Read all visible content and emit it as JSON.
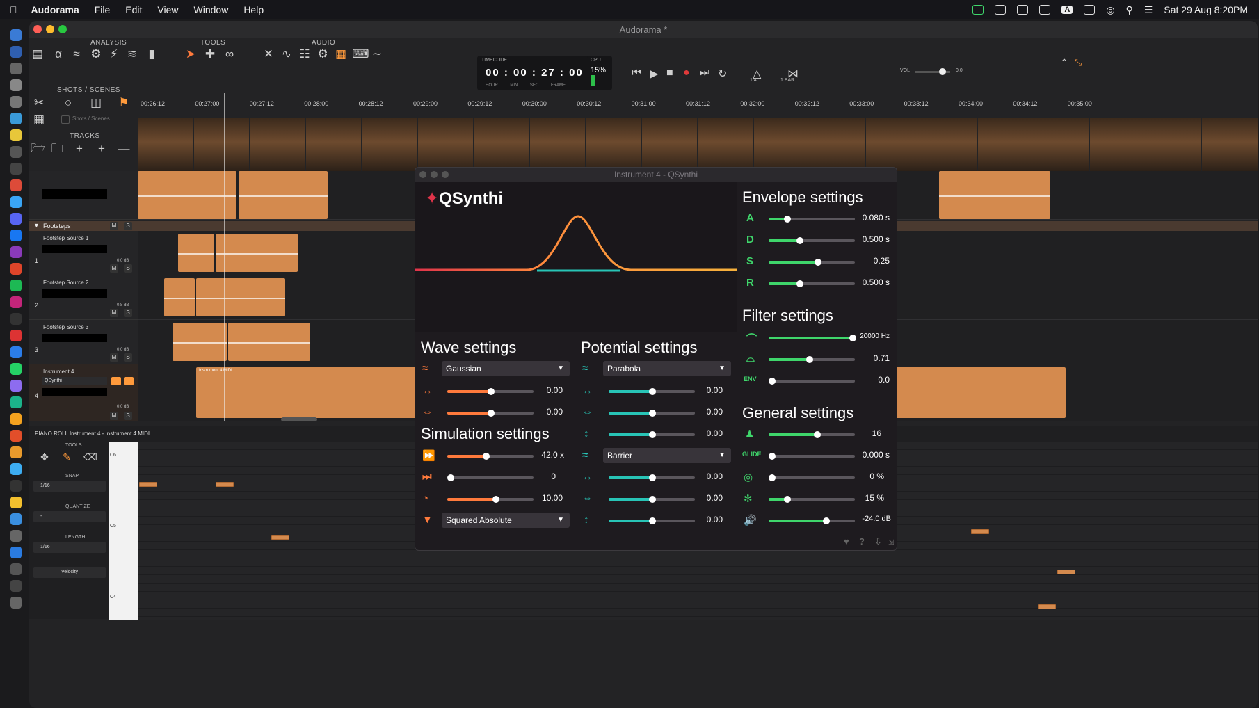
{
  "menubar": {
    "app": "Audorama",
    "items": [
      "File",
      "Edit",
      "View",
      "Window",
      "Help"
    ],
    "datetime": "Sat 29 Aug  8:20PM",
    "badge": "A"
  },
  "window": {
    "title": "Audorama *"
  },
  "toolbar": {
    "analysis": "ANALYSIS",
    "tools": "TOOLS",
    "audio": "AUDIO",
    "shots": "SHOTS / SCENES",
    "tracks": "TRACKS",
    "shots_label": "Shots / Scenes",
    "timecode_label": "TIMECODE",
    "hour": "00",
    "min": "00",
    "sec": "27",
    "frame": "00",
    "units": "HOUR MIN SEC FRAME",
    "cpu_label": "CPU",
    "cpu_value": "15%",
    "vol_label": "VOL",
    "vol_value": "0.0",
    "grid_a": "1/4",
    "grid_b": "1 BAR"
  },
  "ruler": [
    "00:26:12",
    "00:27:00",
    "00:27:12",
    "00:28:00",
    "00:28:12",
    "00:29:00",
    "00:29:12",
    "00:30:00",
    "00:30:12",
    "00:31:00",
    "00:31:12",
    "00:32:00",
    "00:32:12",
    "00:33:00",
    "00:33:12",
    "00:34:00",
    "00:34:12",
    "00:35:00"
  ],
  "tracks": {
    "folder": "Footsteps",
    "items": [
      {
        "name": "Footstep Source 1",
        "num": "1",
        "db": "0.0 dB"
      },
      {
        "name": "Footstep Source 2",
        "num": "2",
        "db": "0.8 dB"
      },
      {
        "name": "Footstep Source 3",
        "num": "3",
        "db": "0.0 dB"
      },
      {
        "name": "Instrument 4",
        "num": "4",
        "db": "0.0 dB",
        "instrument": "QSynthi",
        "clip": "Instrument 4 MIDI"
      }
    ]
  },
  "pianoroll": {
    "header": "PIANO ROLL  Instrument 4 - Instrument 4 MIDI",
    "tools": "TOOLS",
    "snap": "SNAP",
    "snap_val": "1/16",
    "quantize": "QUANTIZE",
    "quantize_val": "-",
    "length": "LENGTH",
    "length_val": "1/16",
    "velocity": "Velocity",
    "keys": [
      "C6",
      "C5",
      "C4"
    ]
  },
  "plugin": {
    "title": "Instrument 4 - QSynthi",
    "logo": "QSynthi",
    "wave": {
      "title": "Wave settings",
      "type": "Gaussian",
      "v1": "0.00",
      "v2": "0.00"
    },
    "potential": {
      "title": "Potential settings",
      "type": "Parabola",
      "v1": "0.00",
      "v2": "0.00",
      "v3": "0.00",
      "type2": "Barrier",
      "v4": "0.00",
      "v5": "0.00",
      "v6": "0.00"
    },
    "simulation": {
      "title": "Simulation settings",
      "speed": "42.0 x",
      "steps": "0",
      "rate": "10.00",
      "norm": "Squared Absolute"
    },
    "envelope": {
      "title": "Envelope settings",
      "A": "0.080 s",
      "D": "0.500 s",
      "S": "0.25",
      "R": "0.500 s"
    },
    "filter": {
      "title": "Filter settings",
      "cutoff": "20000 Hz",
      "res": "0.71",
      "env": "0.0",
      "env_label": "ENV"
    },
    "general": {
      "title": "General settings",
      "voices": "16",
      "glide": "0.000 s",
      "glide_label": "GLIDE",
      "stereo": "0 %",
      "detune": "15 %",
      "volume": "-24.0 dB"
    }
  },
  "colors": {
    "accent": "#ff7a3c",
    "teal": "#28c4b6",
    "green": "#3fd66b",
    "clip": "#d48a4e"
  }
}
